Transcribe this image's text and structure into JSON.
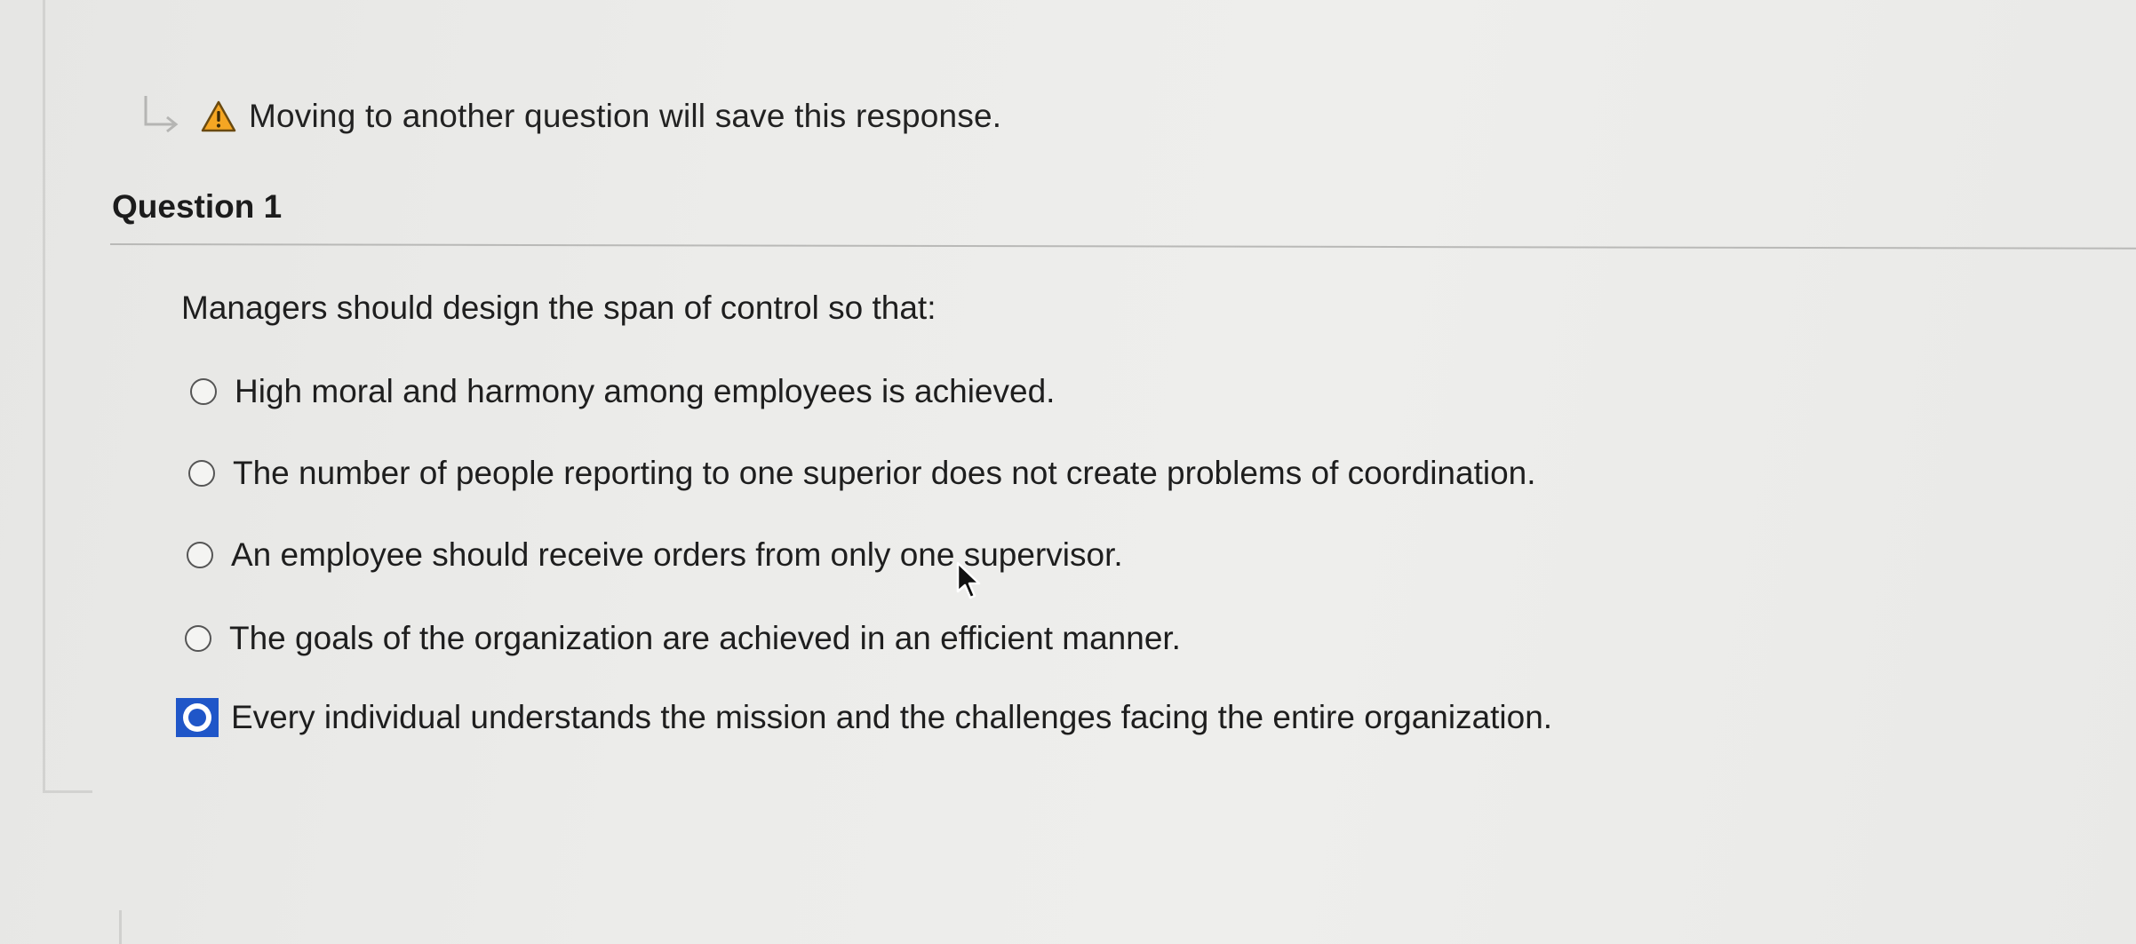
{
  "warning": {
    "icon": "warning-triangle-icon",
    "text": "Moving to another question will save this response."
  },
  "question": {
    "title": "Question 1",
    "prompt": "Managers should design the span of control so that:",
    "options": [
      {
        "label": "High moral and harmony among employees is achieved.",
        "selected": false
      },
      {
        "label": "The number of people reporting to one superior does not create problems of coordination.",
        "selected": false
      },
      {
        "label": "An employee should receive orders from only one supervisor.",
        "selected": false
      },
      {
        "label": "The goals of the organization are achieved in an efficient manner.",
        "selected": false
      },
      {
        "label": "Every individual understands the mission and the challenges facing the entire organization.",
        "selected": true
      }
    ]
  },
  "colors": {
    "accent": "#1f56c8",
    "warning": "#f5a623"
  }
}
